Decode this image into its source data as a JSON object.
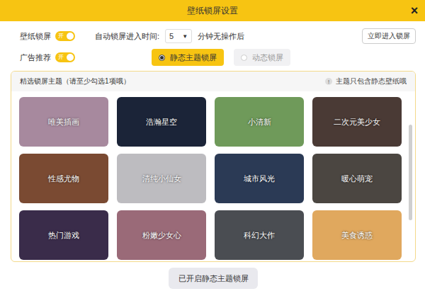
{
  "window": {
    "title": "壁纸锁屏设置",
    "close": "×"
  },
  "settings": {
    "lock_screen": {
      "label": "壁纸锁屏",
      "on": true,
      "toggle_text": "开"
    },
    "auto_lock": {
      "label": "自动锁屏进入时间:",
      "value": "5",
      "arrow": "▼",
      "suffix": "分钟无操作后"
    },
    "ads": {
      "label": "广告推荐",
      "on": true,
      "toggle_text": "开"
    },
    "enter_button": "立即进入锁屏"
  },
  "modes": [
    {
      "label": "静态主题锁屏",
      "selected": true
    },
    {
      "label": "动态锁屏",
      "selected": false
    }
  ],
  "themes": {
    "title": "精选锁屏主题（请至少勾选1项哦）",
    "note_icon": "!",
    "note": "主题只包含静态壁纸哦",
    "items": [
      {
        "label": "唯美插画",
        "color": "#a7899e"
      },
      {
        "label": "浩瀚星空",
        "color": "#1b2438"
      },
      {
        "label": "小清新",
        "color": "#6f9a5a"
      },
      {
        "label": "二次元美少女",
        "color": "#4a3a35"
      },
      {
        "label": "性感尤物",
        "color": "#7a4a32"
      },
      {
        "label": "清纯小仙女",
        "color": "#bdbcc0"
      },
      {
        "label": "城市风光",
        "color": "#2b3a55"
      },
      {
        "label": "暖心萌宠",
        "color": "#4b4641"
      },
      {
        "label": "热门游戏",
        "color": "#3a2c4a"
      },
      {
        "label": "粉嫩少女心",
        "color": "#9a6a78"
      },
      {
        "label": "科幻大作",
        "color": "#4a4d52"
      },
      {
        "label": "美食诱惑",
        "color": "#e0a85e"
      }
    ]
  },
  "footer_button": "已开启静态主题锁屏"
}
